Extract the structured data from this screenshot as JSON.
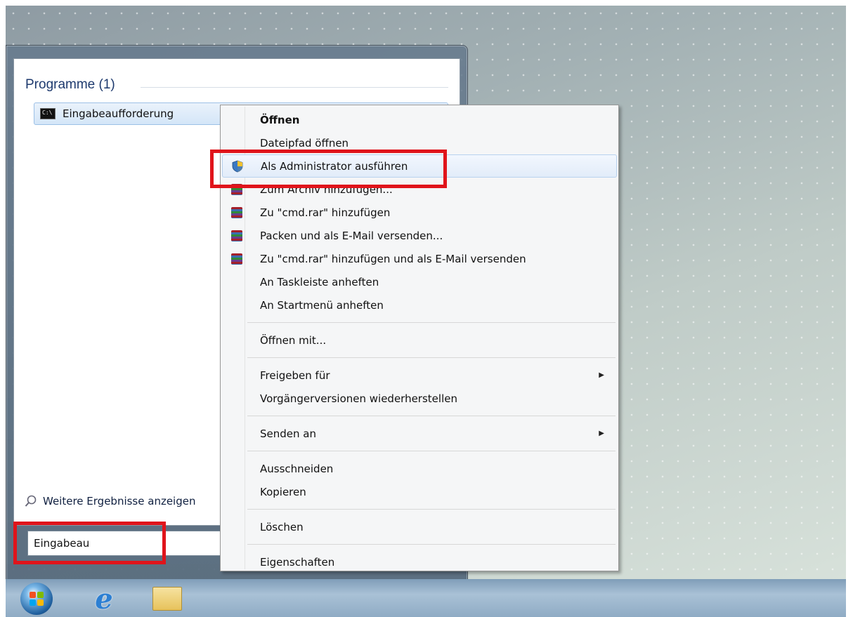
{
  "start_menu": {
    "group_header": "Programme (1)",
    "result_item": "Eingabeaufforderung",
    "more_results": "Weitere Ergebnisse anzeigen",
    "search_value": "Eingabeau"
  },
  "context_menu": {
    "items": [
      {
        "label": "Öffnen"
      },
      {
        "label": "Dateipfad öffnen"
      },
      {
        "label": "Als Administrator ausführen"
      },
      {
        "label": "Zum Archiv hinzufügen..."
      },
      {
        "label": "Zu \"cmd.rar\" hinzufügen"
      },
      {
        "label": "Packen und als E-Mail versenden..."
      },
      {
        "label": "Zu \"cmd.rar\" hinzufügen und als E-Mail versenden"
      },
      {
        "label": "An Taskleiste anheften"
      },
      {
        "label": "An Startmenü anheften"
      },
      {
        "label": "Öffnen mit..."
      },
      {
        "label": "Freigeben für"
      },
      {
        "label": "Vorgängerversionen wiederherstellen"
      },
      {
        "label": "Senden an"
      },
      {
        "label": "Ausschneiden"
      },
      {
        "label": "Kopieren"
      },
      {
        "label": "Löschen"
      },
      {
        "label": "Eigenschaften"
      }
    ]
  },
  "taskbar": {
    "icons": [
      "start-orb-icon",
      "internet-explorer-icon",
      "explorer-folder-icon"
    ]
  },
  "colors": {
    "highlight": "#e0141b",
    "accent": "#1e3a6e"
  }
}
